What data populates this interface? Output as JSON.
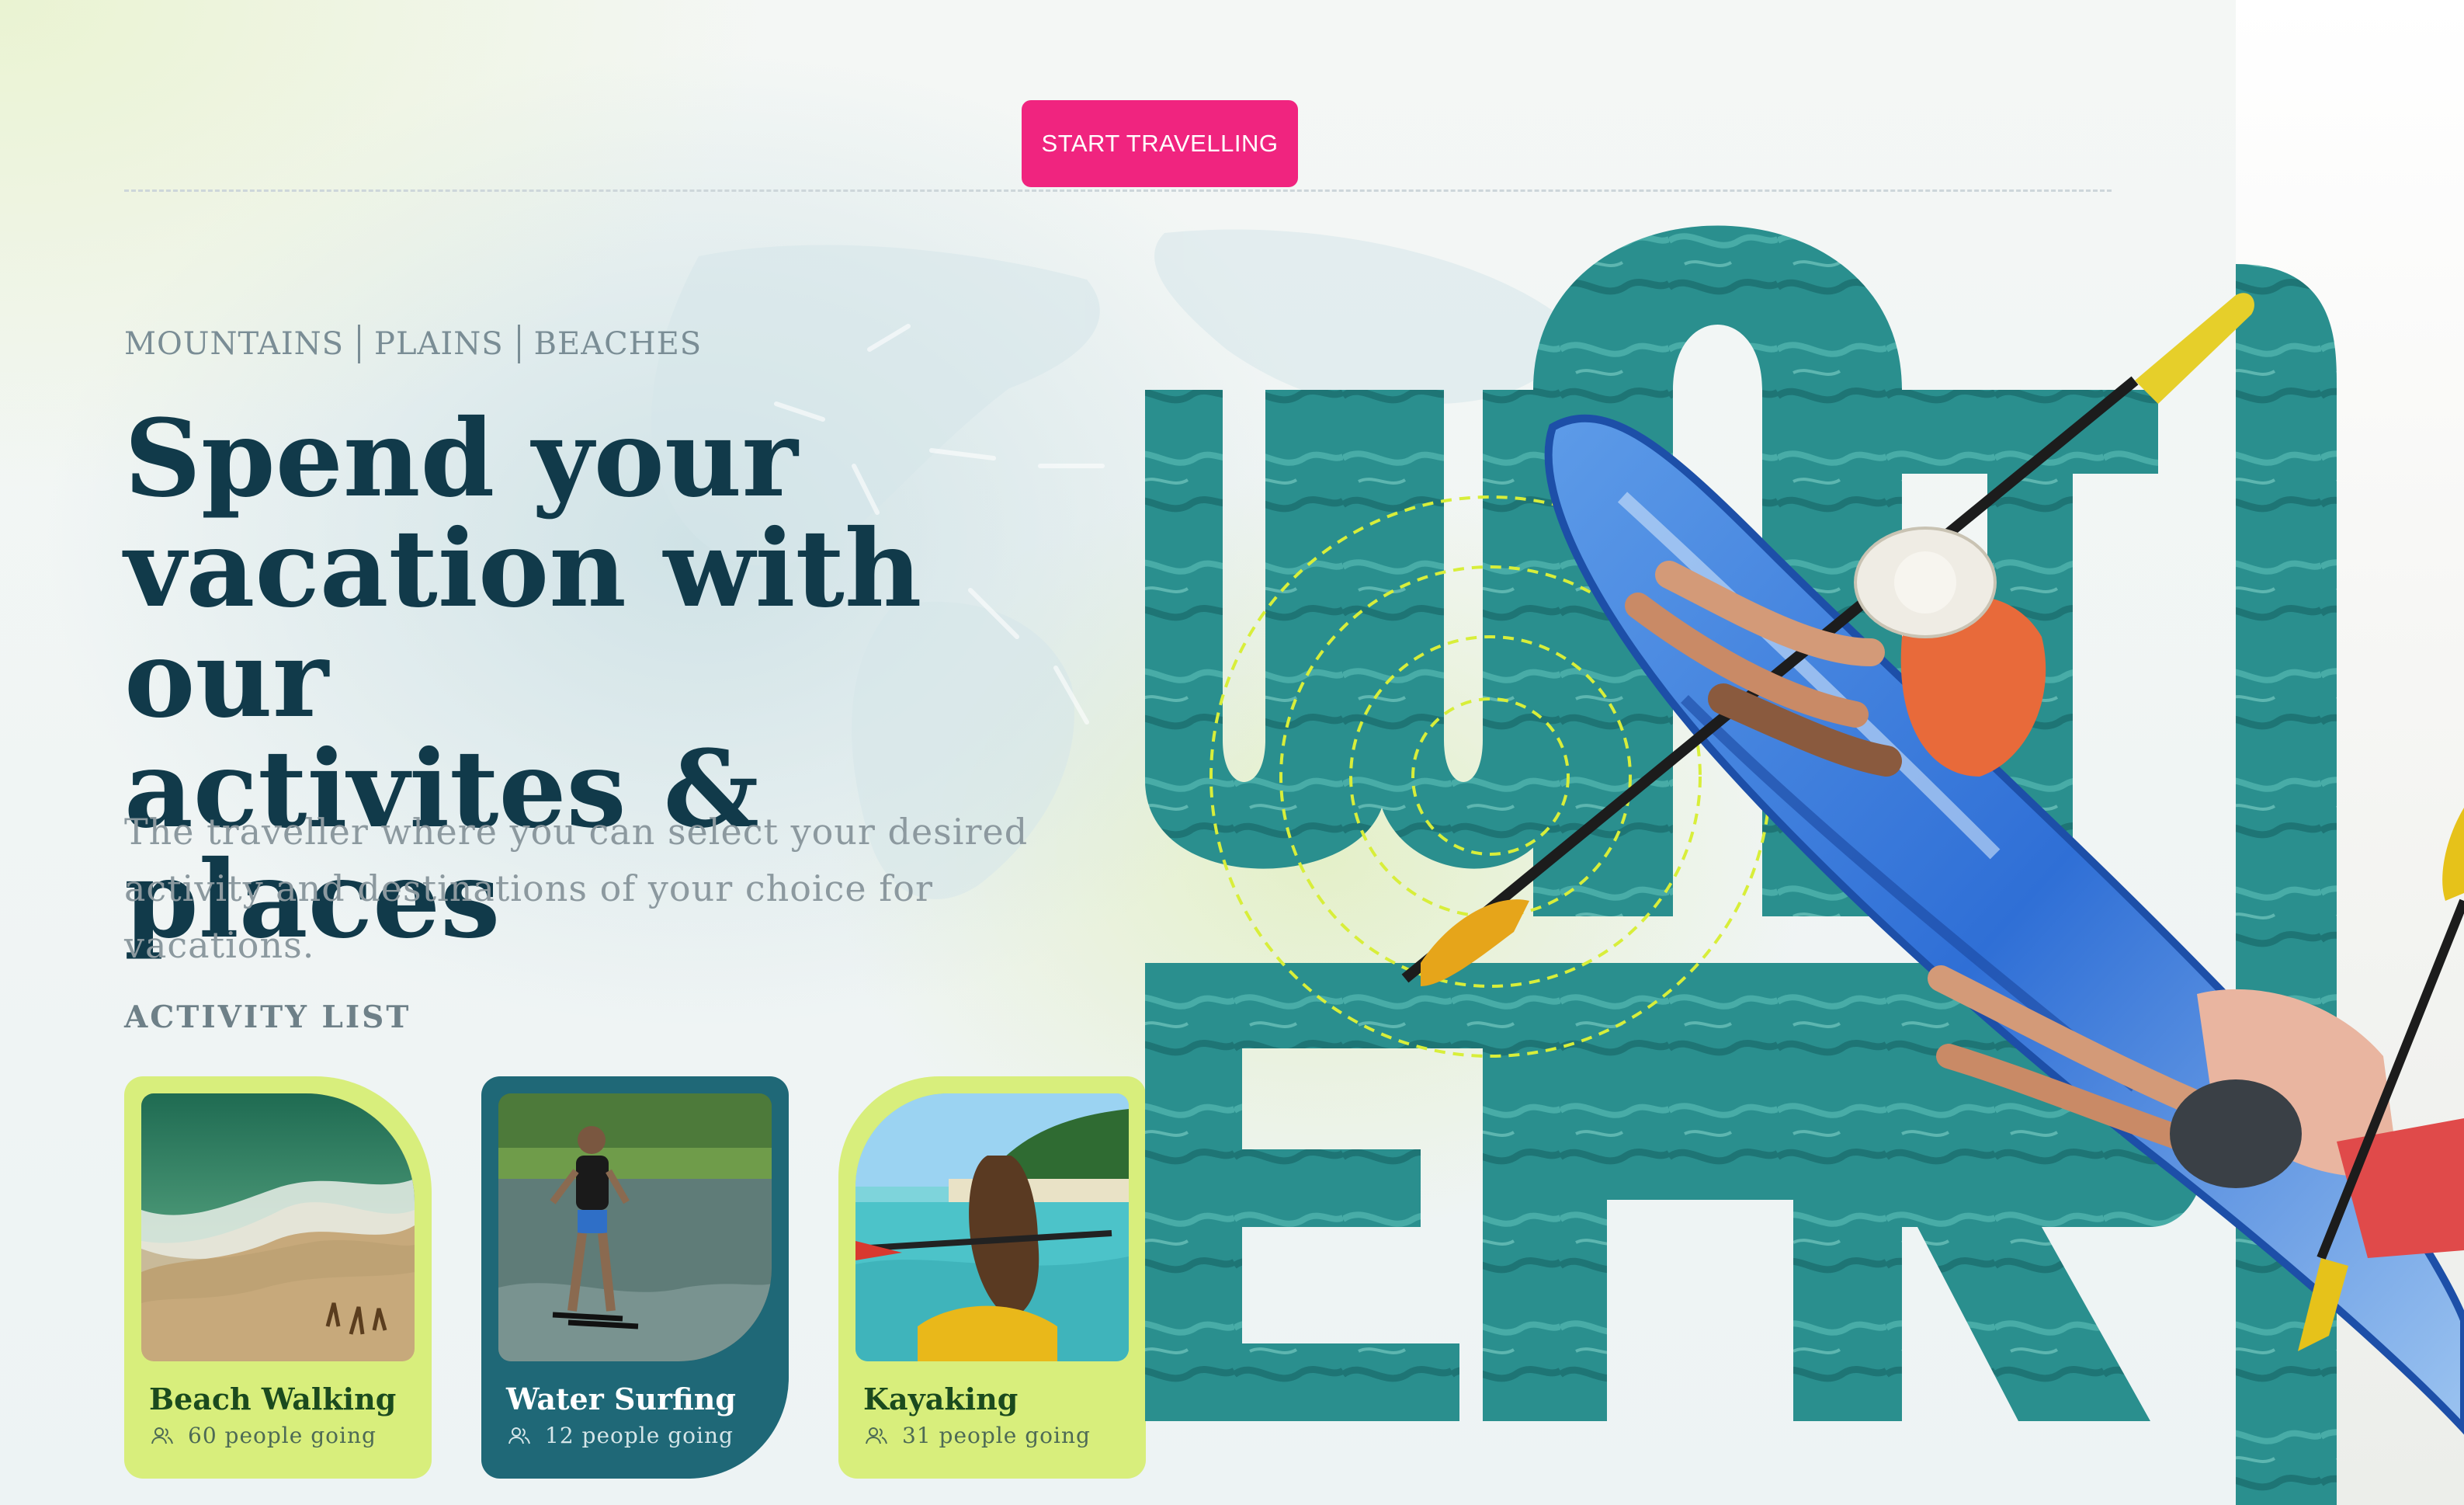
{
  "header": {
    "cta_label": "START TRAVELLING"
  },
  "hero": {
    "categories": [
      "MOUNTAINS",
      "PLAINS",
      "BEACHES"
    ],
    "headline_lines": [
      "Spend your",
      "vacation with our",
      "activites & places"
    ],
    "subtext_lines": [
      "The traveller where you can select your desired",
      "activity and destinations of your choice for vacations."
    ]
  },
  "activities": {
    "section_title": "ACTIVITY LIST",
    "items": [
      {
        "title": "Beach Walking",
        "going": "60 people going"
      },
      {
        "title": "Water Surfing",
        "going": "12 people going"
      },
      {
        "title": "Kayaking",
        "going": "31 people going"
      }
    ]
  },
  "colors": {
    "accent_pink": "#f0247f",
    "heading_navy": "#113a4a",
    "card_lime": "#d8ee7c",
    "card_teal": "#1f6877",
    "water_teal": "#2a8f8e"
  },
  "icons": {
    "people": "users-icon"
  }
}
